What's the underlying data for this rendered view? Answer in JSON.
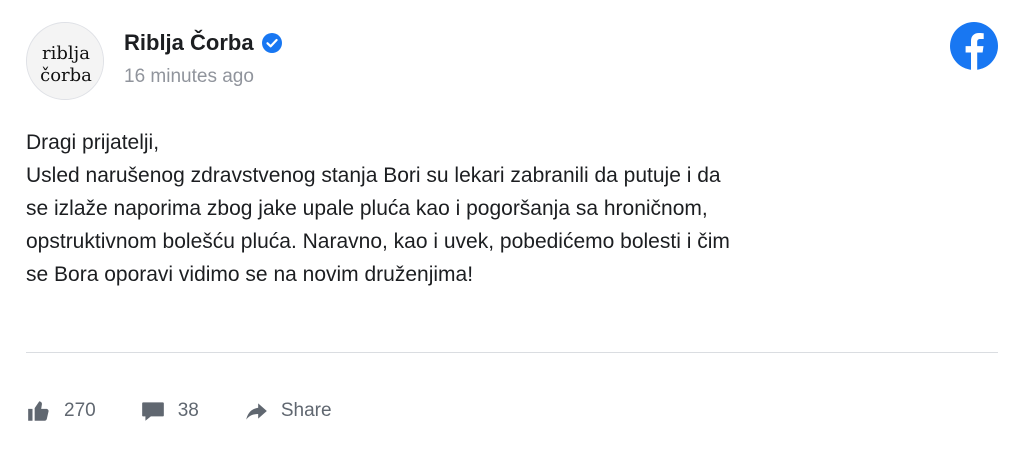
{
  "post": {
    "page_name": "Riblja Čorba",
    "timestamp": "16 minutes ago",
    "avatar_text_line1": "riblja",
    "avatar_text_line2": "čorba",
    "lines": [
      "Dragi prijatelji,",
      "Usled narušenog zdravstvenog stanja Bori su lekari zabranili da putuje i da",
      "se izlaže naporima zbog jake upale pluća kao i pogoršanja sa hroničnom,",
      "opstruktivnom bolešću pluća. Naravno, kao i uvek, pobedićemo bolesti i čim",
      "se Bora oporavi vidimo se na novim druženjima!"
    ]
  },
  "stats": {
    "likes": "270",
    "comments": "38",
    "share_label": "Share"
  },
  "icons": {
    "verified": "verified-badge-icon",
    "brand": "facebook-icon",
    "like": "thumbs-up-icon",
    "comment": "comment-icon",
    "share": "share-arrow-icon"
  },
  "colors": {
    "brand_blue": "#1877f2",
    "text": "#1c1e21",
    "muted": "#90949c",
    "action_gray": "#606770"
  }
}
